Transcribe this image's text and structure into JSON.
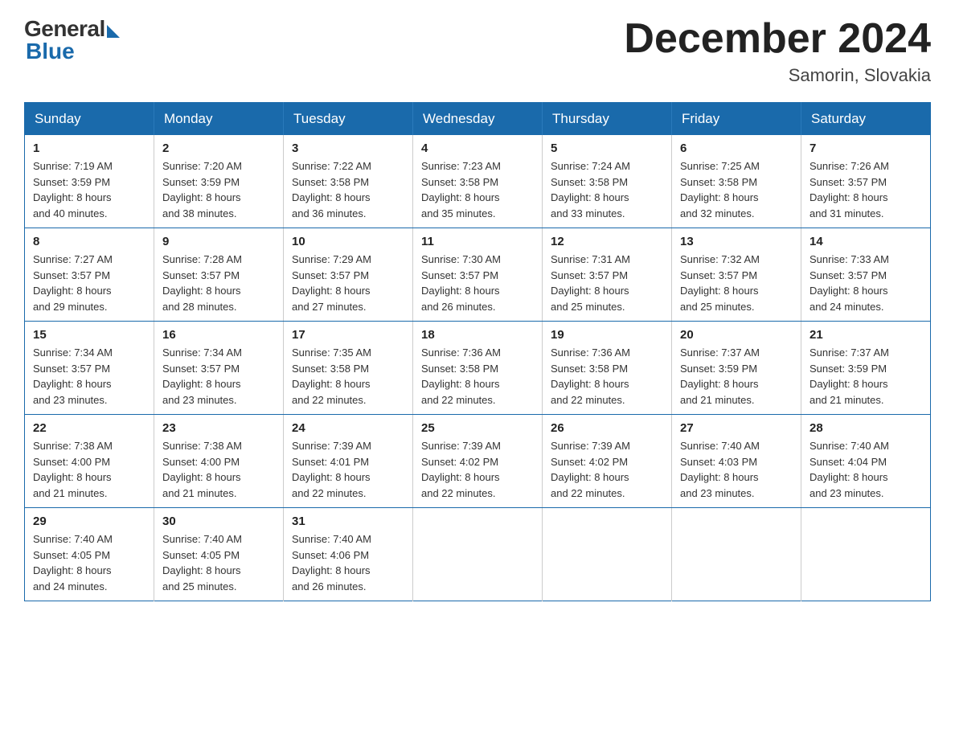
{
  "logo": {
    "general_text": "General",
    "blue_text": "Blue"
  },
  "header": {
    "month_title": "December 2024",
    "location": "Samorin, Slovakia"
  },
  "weekdays": [
    "Sunday",
    "Monday",
    "Tuesday",
    "Wednesday",
    "Thursday",
    "Friday",
    "Saturday"
  ],
  "weeks": [
    [
      {
        "day": "1",
        "sunrise": "7:19 AM",
        "sunset": "3:59 PM",
        "daylight_hours": "8",
        "daylight_minutes": "40"
      },
      {
        "day": "2",
        "sunrise": "7:20 AM",
        "sunset": "3:59 PM",
        "daylight_hours": "8",
        "daylight_minutes": "38"
      },
      {
        "day": "3",
        "sunrise": "7:22 AM",
        "sunset": "3:58 PM",
        "daylight_hours": "8",
        "daylight_minutes": "36"
      },
      {
        "day": "4",
        "sunrise": "7:23 AM",
        "sunset": "3:58 PM",
        "daylight_hours": "8",
        "daylight_minutes": "35"
      },
      {
        "day": "5",
        "sunrise": "7:24 AM",
        "sunset": "3:58 PM",
        "daylight_hours": "8",
        "daylight_minutes": "33"
      },
      {
        "day": "6",
        "sunrise": "7:25 AM",
        "sunset": "3:58 PM",
        "daylight_hours": "8",
        "daylight_minutes": "32"
      },
      {
        "day": "7",
        "sunrise": "7:26 AM",
        "sunset": "3:57 PM",
        "daylight_hours": "8",
        "daylight_minutes": "31"
      }
    ],
    [
      {
        "day": "8",
        "sunrise": "7:27 AM",
        "sunset": "3:57 PM",
        "daylight_hours": "8",
        "daylight_minutes": "29"
      },
      {
        "day": "9",
        "sunrise": "7:28 AM",
        "sunset": "3:57 PM",
        "daylight_hours": "8",
        "daylight_minutes": "28"
      },
      {
        "day": "10",
        "sunrise": "7:29 AM",
        "sunset": "3:57 PM",
        "daylight_hours": "8",
        "daylight_minutes": "27"
      },
      {
        "day": "11",
        "sunrise": "7:30 AM",
        "sunset": "3:57 PM",
        "daylight_hours": "8",
        "daylight_minutes": "26"
      },
      {
        "day": "12",
        "sunrise": "7:31 AM",
        "sunset": "3:57 PM",
        "daylight_hours": "8",
        "daylight_minutes": "25"
      },
      {
        "day": "13",
        "sunrise": "7:32 AM",
        "sunset": "3:57 PM",
        "daylight_hours": "8",
        "daylight_minutes": "25"
      },
      {
        "day": "14",
        "sunrise": "7:33 AM",
        "sunset": "3:57 PM",
        "daylight_hours": "8",
        "daylight_minutes": "24"
      }
    ],
    [
      {
        "day": "15",
        "sunrise": "7:34 AM",
        "sunset": "3:57 PM",
        "daylight_hours": "8",
        "daylight_minutes": "23"
      },
      {
        "day": "16",
        "sunrise": "7:34 AM",
        "sunset": "3:57 PM",
        "daylight_hours": "8",
        "daylight_minutes": "23"
      },
      {
        "day": "17",
        "sunrise": "7:35 AM",
        "sunset": "3:58 PM",
        "daylight_hours": "8",
        "daylight_minutes": "22"
      },
      {
        "day": "18",
        "sunrise": "7:36 AM",
        "sunset": "3:58 PM",
        "daylight_hours": "8",
        "daylight_minutes": "22"
      },
      {
        "day": "19",
        "sunrise": "7:36 AM",
        "sunset": "3:58 PM",
        "daylight_hours": "8",
        "daylight_minutes": "22"
      },
      {
        "day": "20",
        "sunrise": "7:37 AM",
        "sunset": "3:59 PM",
        "daylight_hours": "8",
        "daylight_minutes": "21"
      },
      {
        "day": "21",
        "sunrise": "7:37 AM",
        "sunset": "3:59 PM",
        "daylight_hours": "8",
        "daylight_minutes": "21"
      }
    ],
    [
      {
        "day": "22",
        "sunrise": "7:38 AM",
        "sunset": "4:00 PM",
        "daylight_hours": "8",
        "daylight_minutes": "21"
      },
      {
        "day": "23",
        "sunrise": "7:38 AM",
        "sunset": "4:00 PM",
        "daylight_hours": "8",
        "daylight_minutes": "21"
      },
      {
        "day": "24",
        "sunrise": "7:39 AM",
        "sunset": "4:01 PM",
        "daylight_hours": "8",
        "daylight_minutes": "22"
      },
      {
        "day": "25",
        "sunrise": "7:39 AM",
        "sunset": "4:02 PM",
        "daylight_hours": "8",
        "daylight_minutes": "22"
      },
      {
        "day": "26",
        "sunrise": "7:39 AM",
        "sunset": "4:02 PM",
        "daylight_hours": "8",
        "daylight_minutes": "22"
      },
      {
        "day": "27",
        "sunrise": "7:40 AM",
        "sunset": "4:03 PM",
        "daylight_hours": "8",
        "daylight_minutes": "23"
      },
      {
        "day": "28",
        "sunrise": "7:40 AM",
        "sunset": "4:04 PM",
        "daylight_hours": "8",
        "daylight_minutes": "23"
      }
    ],
    [
      {
        "day": "29",
        "sunrise": "7:40 AM",
        "sunset": "4:05 PM",
        "daylight_hours": "8",
        "daylight_minutes": "24"
      },
      {
        "day": "30",
        "sunrise": "7:40 AM",
        "sunset": "4:05 PM",
        "daylight_hours": "8",
        "daylight_minutes": "25"
      },
      {
        "day": "31",
        "sunrise": "7:40 AM",
        "sunset": "4:06 PM",
        "daylight_hours": "8",
        "daylight_minutes": "26"
      },
      null,
      null,
      null,
      null
    ]
  ],
  "labels": {
    "sunrise": "Sunrise:",
    "sunset": "Sunset:",
    "daylight": "Daylight:",
    "hours_suffix": "hours",
    "and": "and",
    "minutes_suffix": "minutes."
  }
}
